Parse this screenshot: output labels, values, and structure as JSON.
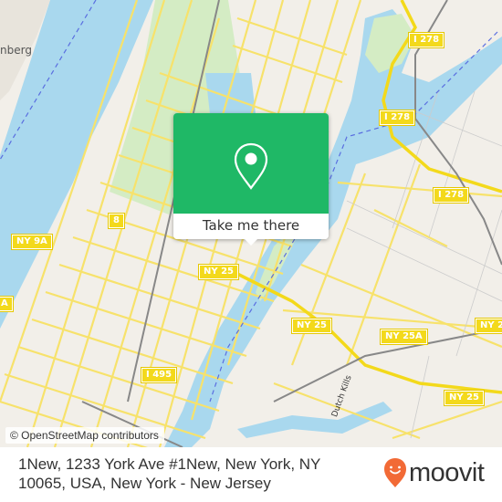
{
  "map": {
    "place_labels": [
      {
        "id": "guttenberg",
        "text": "nberg"
      }
    ],
    "route_shields": [
      {
        "id": "i278-north",
        "text": "I 278"
      },
      {
        "id": "i278-middle",
        "text": "I 278"
      },
      {
        "id": "i278-east",
        "text": "I 278"
      },
      {
        "id": "route-8",
        "text": "8"
      },
      {
        "id": "ny9a",
        "text": "NY 9A"
      },
      {
        "id": "ny9a-edge",
        "text": "A"
      },
      {
        "id": "ny25-west",
        "text": "NY 25"
      },
      {
        "id": "ny25-middle",
        "text": "NY 25"
      },
      {
        "id": "ny25a",
        "text": "NY 25A"
      },
      {
        "id": "ny25-east",
        "text": "NY 25"
      },
      {
        "id": "ny2-edge",
        "text": "NY 2"
      },
      {
        "id": "i495",
        "text": "I 495"
      }
    ],
    "water_label": "Dutch Kills",
    "attribution": "© OpenStreetMap contributors",
    "colors": {
      "land": "#f2efe9",
      "water": "#a9d8ee",
      "park": "#d4ecc4",
      "major_road": "#f7e26b",
      "rail": "#888888",
      "ferry": "#5a6ee0"
    }
  },
  "popup": {
    "icon": "map-pin-icon",
    "button_label": "Take me there",
    "color": "#1fb866"
  },
  "footer": {
    "address_line": "1New, 1233 York Ave #1New, New York, NY 10065, USA, New York - New Jersey",
    "brand": {
      "name": "moovit",
      "icon": "moovit-smile-pin-icon",
      "color": "#f26a36"
    }
  }
}
